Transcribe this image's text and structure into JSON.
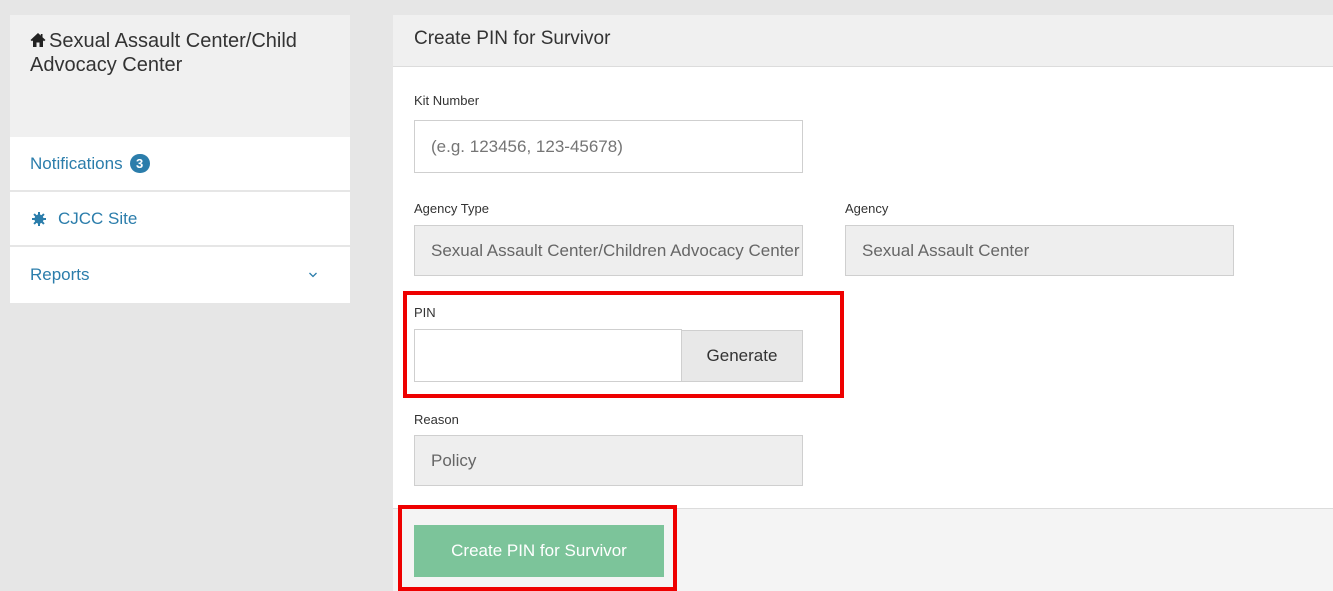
{
  "sidebar": {
    "title": "Sexual Assault Center/Child Advocacy Center",
    "title_icon": "home-icon",
    "notifications_label": "Notifications",
    "notifications_count": "3",
    "site_label": "CJCC Site",
    "site_icon": "gear-icon",
    "reports_label": "Reports"
  },
  "panel": {
    "title": "Create PIN for Survivor",
    "kit_number": {
      "label": "Kit Number",
      "placeholder": "(e.g. 123456, 123-45678)",
      "value": ""
    },
    "agency_type": {
      "label": "Agency Type",
      "value": "Sexual Assault Center/Children Advocacy Center"
    },
    "agency": {
      "label": "Agency",
      "value": "Sexual Assault Center"
    },
    "pin": {
      "label": "PIN",
      "value": "",
      "generate_label": "Generate"
    },
    "reason": {
      "label": "Reason",
      "value": "Policy"
    },
    "submit_label": "Create PIN for Survivor"
  },
  "colors": {
    "link": "#2b7dab",
    "submit_button": "#7cc49a",
    "highlight": "#ee0000"
  }
}
